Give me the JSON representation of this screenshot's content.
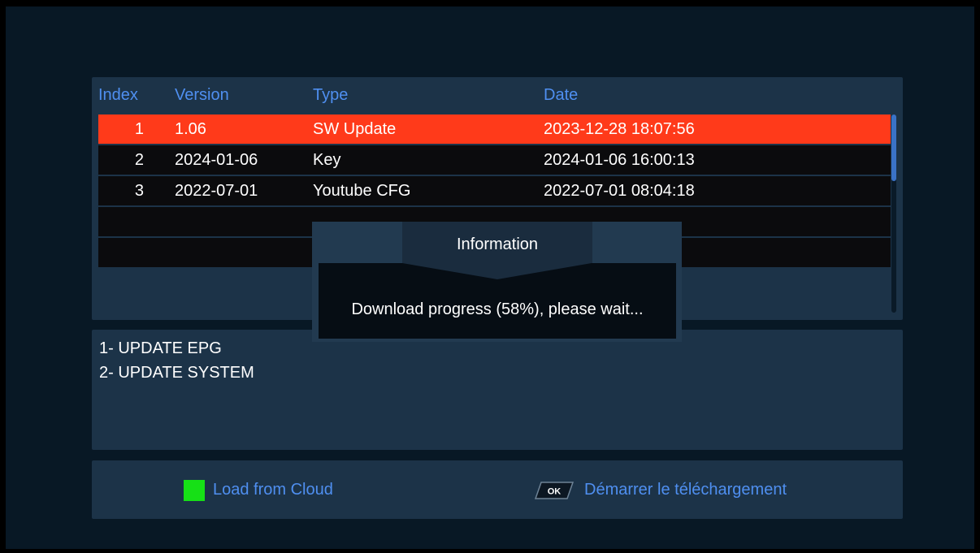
{
  "list": {
    "headers": {
      "index": "Index",
      "version": "Version",
      "type": "Type",
      "date": "Date"
    },
    "rows": [
      {
        "index": "1",
        "version": "1.06",
        "type": "SW Update",
        "date": "2023-12-28 18:07:56",
        "selected": true
      },
      {
        "index": "2",
        "version": "2024-01-06",
        "type": "Key",
        "date": "2024-01-06 16:00:13",
        "selected": false
      },
      {
        "index": "3",
        "version": "2022-07-01",
        "type": "Youtube CFG",
        "date": "2022-07-01 08:04:18",
        "selected": false
      },
      {
        "index": "",
        "version": "",
        "type": "",
        "date": "",
        "selected": false
      },
      {
        "index": "",
        "version": "",
        "type": "",
        "date": "",
        "selected": false
      }
    ]
  },
  "info": {
    "lines": [
      "1- UPDATE EPG",
      "2- UPDATE SYSTEM"
    ]
  },
  "footer": {
    "green_label": "Load from Cloud",
    "ok_key_label": "OK",
    "ok_label": "Démarrer le téléchargement"
  },
  "dialog": {
    "title": "Information",
    "message": "Download progress (58%), please wait...",
    "progress_percent": 58
  },
  "colors": {
    "accent_text": "#4f8ff0",
    "selected_row": "#ff3a1a",
    "green_key": "#16e016",
    "panel": "#1c3348"
  }
}
